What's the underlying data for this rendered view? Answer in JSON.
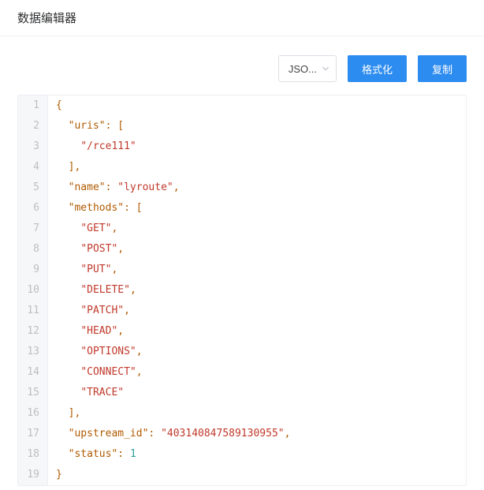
{
  "modal": {
    "title": "数据编辑器"
  },
  "toolbar": {
    "format_select_value": "JSO...",
    "format_btn_label": "格式化",
    "copy_btn_label": "复制"
  },
  "editor": {
    "json_value": {
      "uris": [
        "/rce111"
      ],
      "name": "lyroute",
      "methods": [
        "GET",
        "POST",
        "PUT",
        "DELETE",
        "PATCH",
        "HEAD",
        "OPTIONS",
        "CONNECT",
        "TRACE"
      ],
      "upstream_id": "403140847589130955",
      "status": 1
    },
    "visible_lines": [
      {
        "n": 1,
        "indent": 0,
        "tokens": [
          {
            "t": "punct",
            "v": "{"
          }
        ]
      },
      {
        "n": 2,
        "indent": 1,
        "tokens": [
          {
            "t": "key",
            "v": "\"uris\""
          },
          {
            "t": "punct",
            "v": ": ["
          }
        ]
      },
      {
        "n": 3,
        "indent": 2,
        "tokens": [
          {
            "t": "str",
            "v": "\"/rce111\""
          }
        ]
      },
      {
        "n": 4,
        "indent": 1,
        "tokens": [
          {
            "t": "punct",
            "v": "],"
          }
        ]
      },
      {
        "n": 5,
        "indent": 1,
        "tokens": [
          {
            "t": "key",
            "v": "\"name\""
          },
          {
            "t": "punct",
            "v": ": "
          },
          {
            "t": "str",
            "v": "\"lyroute\""
          },
          {
            "t": "punct",
            "v": ","
          }
        ]
      },
      {
        "n": 6,
        "indent": 1,
        "tokens": [
          {
            "t": "key",
            "v": "\"methods\""
          },
          {
            "t": "punct",
            "v": ": ["
          }
        ]
      },
      {
        "n": 7,
        "indent": 2,
        "tokens": [
          {
            "t": "str",
            "v": "\"GET\""
          },
          {
            "t": "punct",
            "v": ","
          }
        ]
      },
      {
        "n": 8,
        "indent": 2,
        "tokens": [
          {
            "t": "str",
            "v": "\"POST\""
          },
          {
            "t": "punct",
            "v": ","
          }
        ]
      },
      {
        "n": 9,
        "indent": 2,
        "tokens": [
          {
            "t": "str",
            "v": "\"PUT\""
          },
          {
            "t": "punct",
            "v": ","
          }
        ]
      },
      {
        "n": 10,
        "indent": 2,
        "tokens": [
          {
            "t": "str",
            "v": "\"DELETE\""
          },
          {
            "t": "punct",
            "v": ","
          }
        ]
      },
      {
        "n": 11,
        "indent": 2,
        "tokens": [
          {
            "t": "str",
            "v": "\"PATCH\""
          },
          {
            "t": "punct",
            "v": ","
          }
        ]
      },
      {
        "n": 12,
        "indent": 2,
        "tokens": [
          {
            "t": "str",
            "v": "\"HEAD\""
          },
          {
            "t": "punct",
            "v": ","
          }
        ]
      },
      {
        "n": 13,
        "indent": 2,
        "tokens": [
          {
            "t": "str",
            "v": "\"OPTIONS\""
          },
          {
            "t": "punct",
            "v": ","
          }
        ]
      },
      {
        "n": 14,
        "indent": 2,
        "tokens": [
          {
            "t": "str",
            "v": "\"CONNECT\""
          },
          {
            "t": "punct",
            "v": ","
          }
        ]
      },
      {
        "n": 15,
        "indent": 2,
        "tokens": [
          {
            "t": "str",
            "v": "\"TRACE\""
          }
        ]
      },
      {
        "n": 16,
        "indent": 1,
        "tokens": [
          {
            "t": "punct",
            "v": "],"
          }
        ]
      },
      {
        "n": 17,
        "indent": 1,
        "tokens": [
          {
            "t": "key",
            "v": "\"upstream_id\""
          },
          {
            "t": "punct",
            "v": ": "
          },
          {
            "t": "str",
            "v": "\"403140847589130955\""
          },
          {
            "t": "punct",
            "v": ","
          }
        ]
      },
      {
        "n": 18,
        "indent": 1,
        "tokens": [
          {
            "t": "key",
            "v": "\"status\""
          },
          {
            "t": "punct",
            "v": ": "
          },
          {
            "t": "num",
            "v": "1"
          }
        ]
      },
      {
        "n": 19,
        "indent": 0,
        "tokens": [
          {
            "t": "punct",
            "v": "}"
          }
        ]
      }
    ]
  }
}
